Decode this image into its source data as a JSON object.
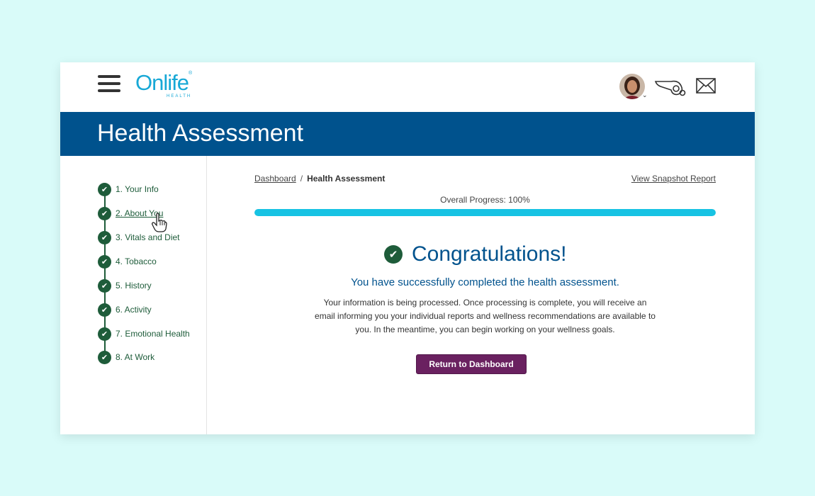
{
  "header": {
    "logo_text": "Onlife",
    "logo_sub": "HEALTH",
    "logo_mark": "®",
    "user_avatar": "avatar",
    "icons": [
      "menu-icon",
      "whistle-icon",
      "mail-icon"
    ]
  },
  "banner": {
    "title": "Health Assessment"
  },
  "sidebar": {
    "steps": [
      {
        "label": "1. Your Info"
      },
      {
        "label": "2. About You"
      },
      {
        "label": "3. Vitals and Diet"
      },
      {
        "label": "4. Tobacco"
      },
      {
        "label": "5. History"
      },
      {
        "label": "6. Activity"
      },
      {
        "label": "7. Emotional Health"
      },
      {
        "label": "8. At Work"
      }
    ]
  },
  "main": {
    "breadcrumb": {
      "home": "Dashboard",
      "sep": "/",
      "current": "Health Assessment"
    },
    "snapshot_link": "View Snapshot Report",
    "progress_label": "Overall Progress: 100%",
    "progress_value": 1.0,
    "congrats_title": "Congratulations!",
    "subtitle": "You have successfully completed the health assessment.",
    "body": "Your information is being processed. Once processing is complete, you will receive an email informing you your individual reports and wellness recommendations are available to you. In the meantime, you can begin working on your wellness goals.",
    "button_label": "Return to Dashboard"
  },
  "colors": {
    "banner": "#00528d",
    "accent_green": "#1e5c3a",
    "progress": "#17c3e3",
    "button": "#6a2160",
    "logo": "#17a8d6"
  }
}
